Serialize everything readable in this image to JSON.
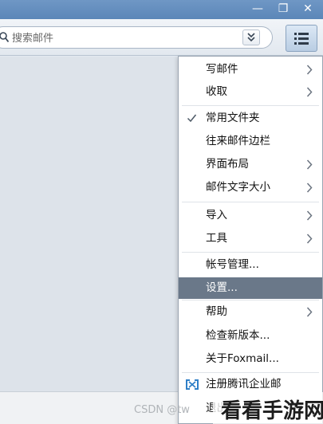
{
  "window": {
    "min_glyph": "—",
    "max_glyph": "❐",
    "close_glyph": "✕"
  },
  "search": {
    "placeholder": "搜索邮件"
  },
  "menu": {
    "items": [
      {
        "label": "写邮件",
        "submenu": true
      },
      {
        "label": "收取",
        "submenu": true
      },
      {
        "label": "常用文件夹",
        "checked": true
      },
      {
        "label": "往来邮件边栏"
      },
      {
        "label": "界面布局",
        "submenu": true
      },
      {
        "label": "邮件文字大小",
        "submenu": true
      },
      {
        "label": "导入",
        "submenu": true
      },
      {
        "label": "工具",
        "submenu": true
      },
      {
        "label": "帐号管理..."
      },
      {
        "label": "设置...",
        "highlighted": true
      },
      {
        "label": "帮助",
        "submenu": true
      },
      {
        "label": "检查新版本..."
      },
      {
        "label": "关于Foxmail..."
      },
      {
        "label": "注册腾讯企业邮",
        "icon": "tencent-exmail-icon"
      },
      {
        "label": "退出"
      }
    ]
  },
  "watermark": {
    "csdn": "CSDN @tw",
    "brand": "看看手游网"
  },
  "colors": {
    "titlebar": "#5b86b8",
    "highlight": "#6a7889",
    "menu_border": "#9aa5b2",
    "content_bg": "#dde3ea"
  }
}
